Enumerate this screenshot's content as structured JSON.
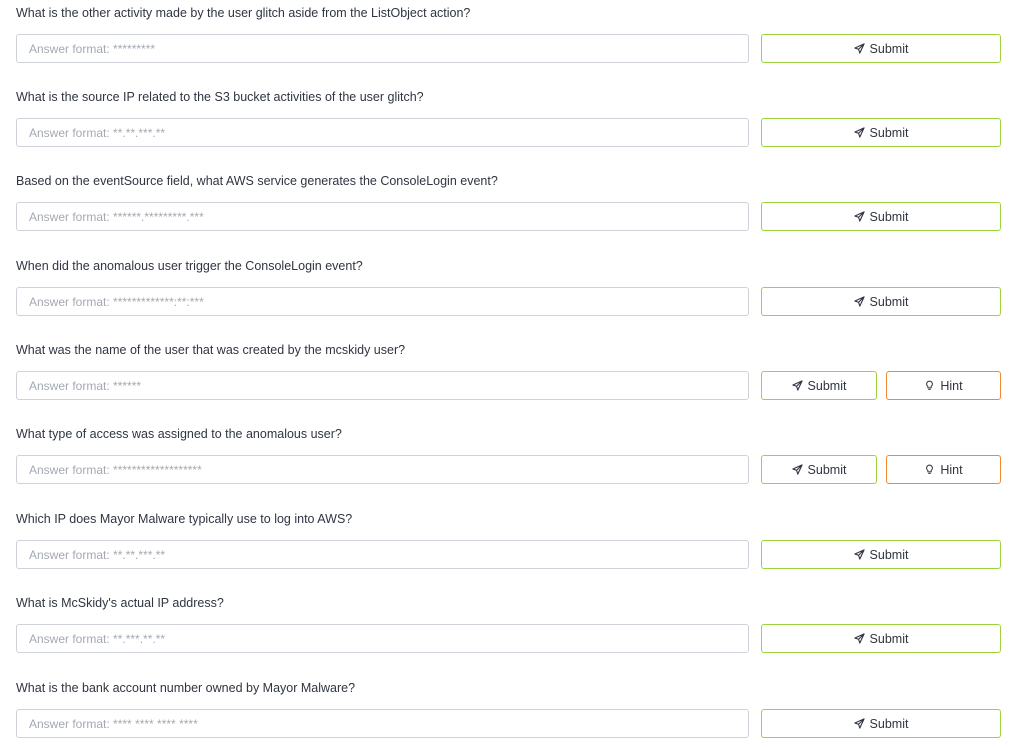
{
  "colors": {
    "submit_border": "#9fd33e",
    "hint_border": "#ef8a34",
    "input_border": "#cfd3d9",
    "placeholder": "#a4a9b1"
  },
  "icons": {
    "submit": "paper-plane-icon",
    "hint": "lightbulb-icon"
  },
  "questions": [
    {
      "text": "What is the other activity made by the user glitch aside from the ListObject action?",
      "value": "",
      "placeholder": "Answer format: *********",
      "submit_label": "Submit"
    },
    {
      "text": "What is the source IP related to the S3 bucket activities of the user glitch?",
      "value": "",
      "placeholder": "Answer format: **.**.***.**",
      "submit_label": "Submit"
    },
    {
      "text": "Based on the eventSource field, what AWS service generates the ConsoleLogin event?",
      "value": "",
      "placeholder": "Answer format: ******.*********.***",
      "submit_label": "Submit"
    },
    {
      "text": "When did the anomalous user trigger the ConsoleLogin event?",
      "value": "",
      "placeholder": "Answer format: *************:**:***",
      "submit_label": "Submit"
    },
    {
      "text": "What was the name of the user that was created by the mcskidy user?",
      "value": "",
      "placeholder": "Answer format: ******",
      "submit_label": "Submit",
      "hint_label": "Hint"
    },
    {
      "text": "What type of access was assigned to the anomalous user?",
      "value": "",
      "placeholder": "Answer format: *******************",
      "submit_label": "Submit",
      "hint_label": "Hint"
    },
    {
      "text": "Which IP does Mayor Malware typically use to log into AWS?",
      "value": "",
      "placeholder": "Answer format: **.**.***.**",
      "submit_label": "Submit"
    },
    {
      "text": "What is McSkidy's actual IP address?",
      "value": "",
      "placeholder": "Answer format: **.***.**.**",
      "submit_label": "Submit"
    },
    {
      "text": "What is the bank account number owned by Mayor Malware?",
      "value": "",
      "placeholder": "Answer format: **** **** **** ****",
      "submit_label": "Submit"
    }
  ]
}
